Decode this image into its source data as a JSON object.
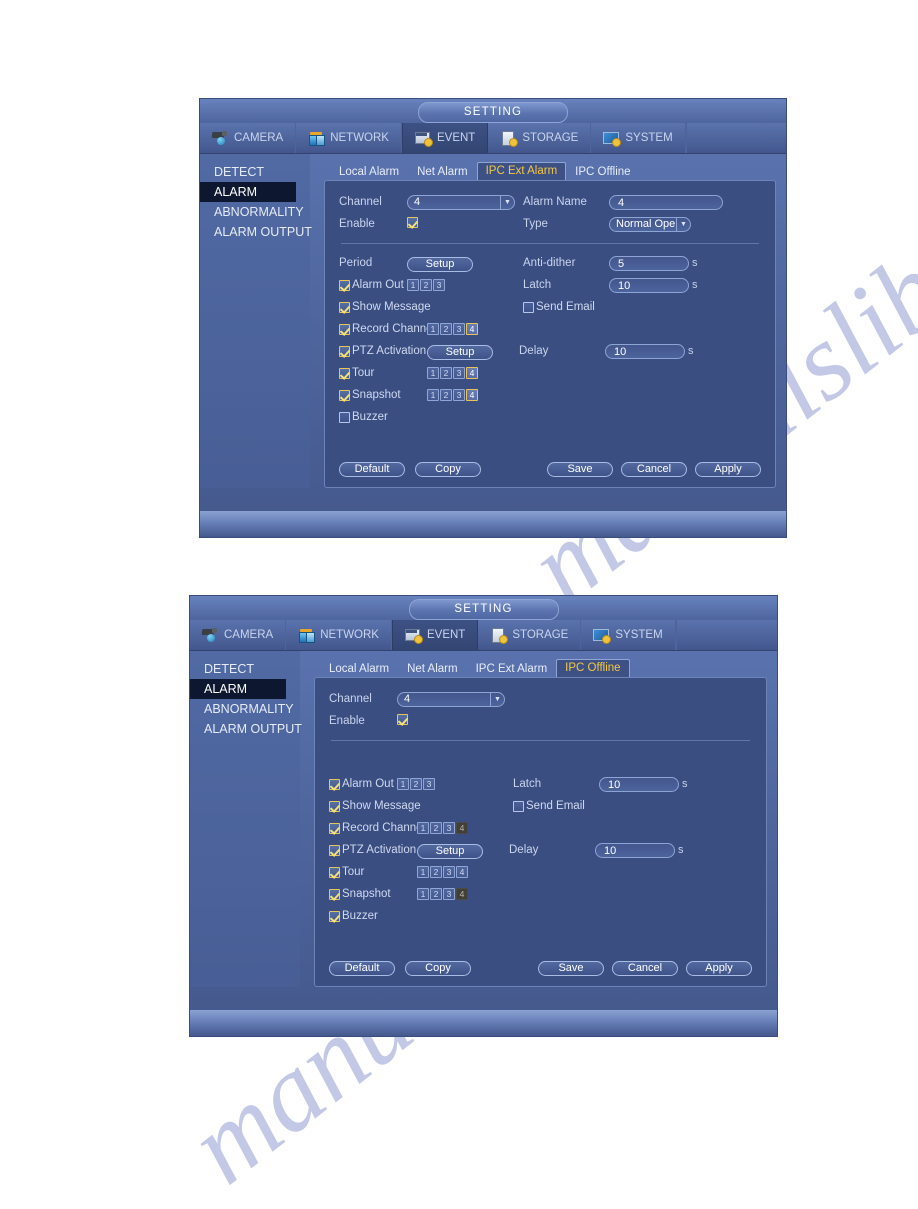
{
  "page": {
    "watermark": "manualslib.com"
  },
  "window_title": "SETTING",
  "top_tabs": [
    {
      "label": "CAMERA",
      "icon": "camera-icon",
      "active": false
    },
    {
      "label": "NETWORK",
      "icon": "network-icon",
      "active": false
    },
    {
      "label": "EVENT",
      "icon": "event-icon",
      "active": true
    },
    {
      "label": "STORAGE",
      "icon": "storage-icon",
      "active": false
    },
    {
      "label": "SYSTEM",
      "icon": "system-icon",
      "active": false
    }
  ],
  "sidebar": {
    "items": [
      {
        "label": "DETECT",
        "active": false
      },
      {
        "label": "ALARM",
        "active": true
      },
      {
        "label": "ABNORMALITY",
        "active": false
      },
      {
        "label": "ALARM OUTPUT",
        "active": false
      }
    ]
  },
  "colors": {
    "accent_yellow": "#f4c842",
    "panel_bg": "#3b4e82",
    "window_bg": "#50679f",
    "sidebar_active_bg": "#0d1730",
    "checkbox_on_border": "#e8c55a",
    "disabled_box": "#413f38"
  },
  "dialog1": {
    "sub_tabs": [
      {
        "label": "Local Alarm",
        "active": false
      },
      {
        "label": "Net Alarm",
        "active": false
      },
      {
        "label": "IPC Ext Alarm",
        "active": true
      },
      {
        "label": "IPC Offline",
        "active": false
      }
    ],
    "channel": {
      "label": "Channel",
      "value": "4"
    },
    "alarm_name": {
      "label": "Alarm Name",
      "value": "4"
    },
    "enable": {
      "label": "Enable",
      "checked": true
    },
    "type": {
      "label": "Type",
      "value": "Normal Open"
    },
    "period": {
      "label": "Period",
      "button": "Setup"
    },
    "anti_dither": {
      "label": "Anti-dither",
      "value": "5",
      "unit": "s"
    },
    "alarm_out": {
      "label": "Alarm Out",
      "checked": true,
      "boxes": [
        {
          "n": "1",
          "state": "normal"
        },
        {
          "n": "2",
          "state": "normal"
        },
        {
          "n": "3",
          "state": "normal"
        }
      ]
    },
    "latch": {
      "label": "Latch",
      "value": "10",
      "unit": "s"
    },
    "show_message": {
      "label": "Show Message",
      "checked": true
    },
    "send_email": {
      "label": "Send Email",
      "checked": false
    },
    "record_channel": {
      "label": "Record Channel",
      "checked": true,
      "boxes": [
        {
          "n": "1",
          "state": "normal"
        },
        {
          "n": "2",
          "state": "normal"
        },
        {
          "n": "3",
          "state": "normal"
        },
        {
          "n": "4",
          "state": "selected"
        }
      ]
    },
    "ptz_activation": {
      "label": "PTZ Activation",
      "checked": true,
      "button": "Setup"
    },
    "delay": {
      "label": "Delay",
      "value": "10",
      "unit": "s"
    },
    "tour": {
      "label": "Tour",
      "checked": true,
      "boxes": [
        {
          "n": "1",
          "state": "normal"
        },
        {
          "n": "2",
          "state": "normal"
        },
        {
          "n": "3",
          "state": "normal"
        },
        {
          "n": "4",
          "state": "selected"
        }
      ]
    },
    "snapshot": {
      "label": "Snapshot",
      "checked": true,
      "boxes": [
        {
          "n": "1",
          "state": "normal"
        },
        {
          "n": "2",
          "state": "normal"
        },
        {
          "n": "3",
          "state": "normal"
        },
        {
          "n": "4",
          "state": "selected"
        }
      ]
    },
    "buzzer": {
      "label": "Buzzer",
      "checked": false
    },
    "buttons": {
      "default": "Default",
      "copy": "Copy",
      "save": "Save",
      "cancel": "Cancel",
      "apply": "Apply"
    }
  },
  "dialog2": {
    "sub_tabs": [
      {
        "label": "Local Alarm",
        "active": false
      },
      {
        "label": "Net Alarm",
        "active": false
      },
      {
        "label": "IPC Ext Alarm",
        "active": false
      },
      {
        "label": "IPC Offline",
        "active": true
      }
    ],
    "channel": {
      "label": "Channel",
      "value": "4"
    },
    "enable": {
      "label": "Enable",
      "checked": true
    },
    "alarm_out": {
      "label": "Alarm Out",
      "checked": true,
      "boxes": [
        {
          "n": "1",
          "state": "normal"
        },
        {
          "n": "2",
          "state": "normal"
        },
        {
          "n": "3",
          "state": "normal"
        }
      ]
    },
    "latch": {
      "label": "Latch",
      "value": "10",
      "unit": "s"
    },
    "show_message": {
      "label": "Show Message",
      "checked": true
    },
    "send_email": {
      "label": "Send Email",
      "checked": false
    },
    "record_channel": {
      "label": "Record Channel",
      "checked": true,
      "boxes": [
        {
          "n": "1",
          "state": "normal"
        },
        {
          "n": "2",
          "state": "normal"
        },
        {
          "n": "3",
          "state": "normal"
        },
        {
          "n": "4",
          "state": "disabled"
        }
      ]
    },
    "ptz_activation": {
      "label": "PTZ Activation",
      "checked": true,
      "button": "Setup"
    },
    "delay": {
      "label": "Delay",
      "value": "10",
      "unit": "s"
    },
    "tour": {
      "label": "Tour",
      "checked": true,
      "boxes": [
        {
          "n": "1",
          "state": "normal"
        },
        {
          "n": "2",
          "state": "normal"
        },
        {
          "n": "3",
          "state": "normal"
        },
        {
          "n": "4",
          "state": "normal"
        }
      ]
    },
    "snapshot": {
      "label": "Snapshot",
      "checked": true,
      "boxes": [
        {
          "n": "1",
          "state": "normal"
        },
        {
          "n": "2",
          "state": "normal"
        },
        {
          "n": "3",
          "state": "normal"
        },
        {
          "n": "4",
          "state": "disabled"
        }
      ]
    },
    "buzzer": {
      "label": "Buzzer",
      "checked": true
    },
    "buttons": {
      "default": "Default",
      "copy": "Copy",
      "save": "Save",
      "cancel": "Cancel",
      "apply": "Apply"
    }
  }
}
